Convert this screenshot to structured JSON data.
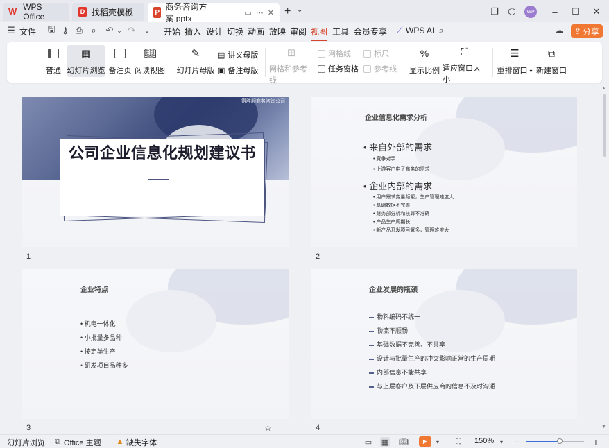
{
  "titlebar": {
    "tabs": [
      {
        "label": "WPS Office",
        "icon": "wps-logo-icon"
      },
      {
        "label": "找稻壳模板",
        "icon": "docer-logo-icon"
      },
      {
        "label": "商务咨询方案.pptx",
        "icon": "pptx-file-icon"
      }
    ],
    "avatar_text": "WP"
  },
  "menubar": {
    "file_label": "文件",
    "tabs": [
      "开始",
      "插入",
      "设计",
      "切换",
      "动画",
      "放映",
      "审阅",
      "视图",
      "工具",
      "会员专享"
    ],
    "active_tab": "视图",
    "wps_ai_label": "WPS AI",
    "share_label": "分享"
  },
  "ribbon": {
    "normal": "普通",
    "slide_sorter": "幻灯片浏览",
    "notes_page": "备注页",
    "reading_view": "阅读视图",
    "slide_master": "幻灯片母版",
    "handout_master": "讲义母版",
    "notes_master": "备注母版",
    "grid_guides": "网格和参考线",
    "gridlines": "网格线",
    "ruler": "标尺",
    "task_pane": "任务窗格",
    "guides": "参考线",
    "zoom": "显示比例",
    "fit_window": "适应窗口大小",
    "arrange_all": "重排窗口",
    "new_window": "新建窗口"
  },
  "slides": [
    {
      "number": "1",
      "tag": "得胜起商务咨询公司",
      "title": "公司企业信息化规划建议书"
    },
    {
      "number": "2",
      "title": "企业信息化需求分析",
      "sections": [
        {
          "heading": "来自外部的需求",
          "items": [
            "竞争对手",
            "上游客户电子商务的需求"
          ]
        },
        {
          "heading": "企业内部的需求",
          "items": [
            "用户需求变量频繁，生产管理难度大",
            "基础数据不完善",
            "财务部分析和核算不准确",
            "产品生产周期长",
            "新产品开发项目繁多，管理难度大"
          ]
        }
      ]
    },
    {
      "number": "3",
      "title": "企业特点",
      "items": [
        "机电一体化",
        "小批量多品种",
        "按定单生产",
        "研发项目品种多"
      ]
    },
    {
      "number": "4",
      "title": "企业发展的瓶颈",
      "items": [
        "物料编码不统一",
        "物流不顺畅",
        "基础数据不完善、不共享",
        "设计与批量生产的冲突影响正常的生产周期",
        "内部信息不能共享",
        "与上层客户及下层供应商的信息不及时沟通"
      ]
    }
  ],
  "statusbar": {
    "view_mode": "幻灯片浏览",
    "theme": "Office 主题",
    "missing_fonts": "缺失字体",
    "zoom": "150%",
    "zoom_level_fraction": 0.57
  },
  "colors": {
    "accent": "#d6452b",
    "share": "#f07832",
    "slide_navy": "#4c5580"
  }
}
